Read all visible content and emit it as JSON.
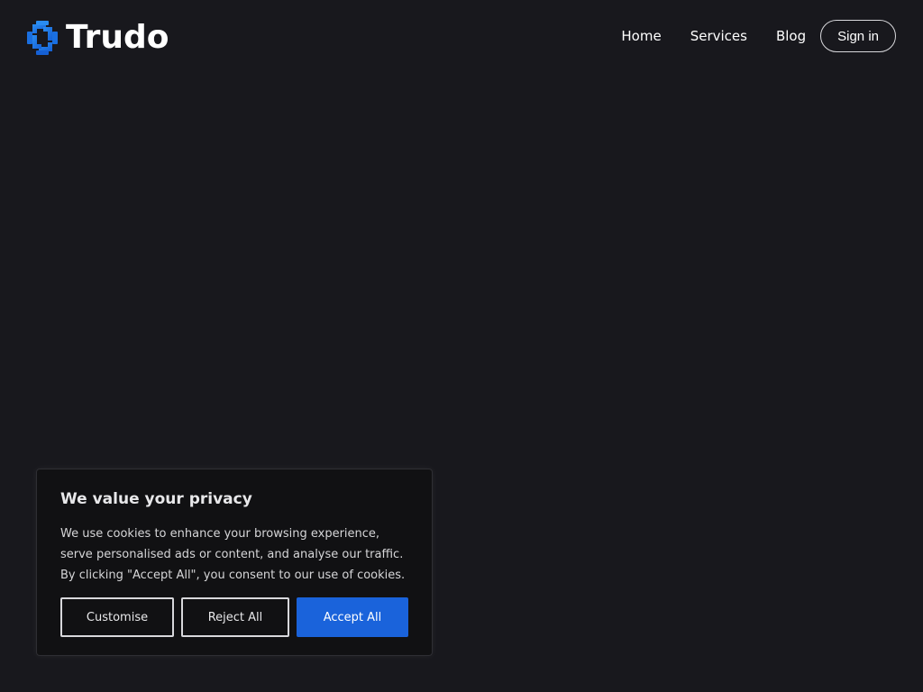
{
  "brand": {
    "name": "Trudo",
    "logo_icon": "trudo-logo-icon",
    "accent_color": "#1a73e8"
  },
  "nav": {
    "items": [
      {
        "label": "Home"
      },
      {
        "label": "Services"
      },
      {
        "label": "Blog"
      }
    ],
    "signin_label": "Sign in"
  },
  "cookie_banner": {
    "title": "We value your privacy",
    "text": "We use cookies to enhance your browsing experience, serve personalised ads or content, and analyse our traffic. By clicking \"Accept All\", you consent to our use of cookies.",
    "customise_label": "Customise",
    "reject_label": "Reject All",
    "accept_label": "Accept All",
    "accept_color": "#1a63db"
  }
}
